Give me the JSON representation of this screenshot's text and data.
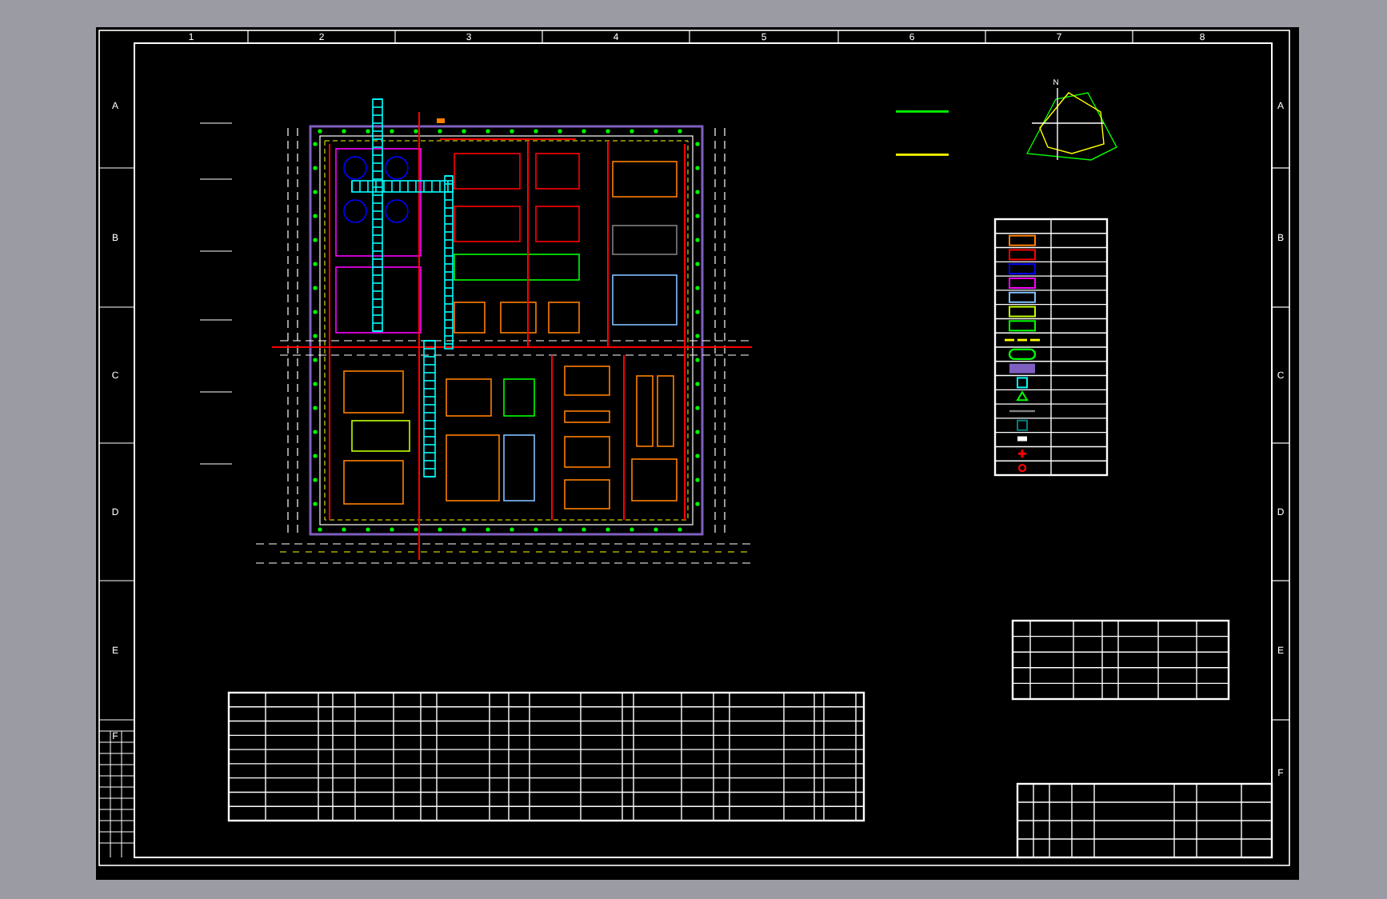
{
  "sheet": {
    "column_labels": [
      "1",
      "2",
      "3",
      "4",
      "5",
      "6",
      "7",
      "8"
    ],
    "row_labels_left": [
      "A",
      "B",
      "C",
      "D",
      "E",
      "F"
    ],
    "row_labels_right": [
      "A",
      "B",
      "C",
      "D",
      "E",
      "F"
    ],
    "compass": {
      "label": "N"
    },
    "wind_lines": [
      {
        "color": "#00ff00"
      },
      {
        "color": "#ffff00"
      }
    ],
    "legend": [
      {
        "kind": "rect",
        "color": "#ff8000"
      },
      {
        "kind": "rect",
        "color": "#ff0000"
      },
      {
        "kind": "rect",
        "color": "#0000ff"
      },
      {
        "kind": "rect",
        "color": "#ff00ff"
      },
      {
        "kind": "rect",
        "color": "#80c0ff"
      },
      {
        "kind": "rect",
        "color": "#c0ff00"
      },
      {
        "kind": "rect",
        "color": "#00ff00"
      },
      {
        "kind": "dashes",
        "color": "#ffff00"
      },
      {
        "kind": "hedge",
        "color": "#00ff00"
      },
      {
        "kind": "fill",
        "color": "#7f5fbf"
      },
      {
        "kind": "square",
        "color": "#00ffff"
      },
      {
        "kind": "tree",
        "color": "#00ff00"
      },
      {
        "kind": "line",
        "color": "#808080"
      },
      {
        "kind": "square",
        "color": "#008080"
      },
      {
        "kind": "lamp",
        "color": "#ffffff"
      },
      {
        "kind": "cross",
        "color": "#ff0000"
      },
      {
        "kind": "ring",
        "color": "#ff0000"
      }
    ]
  }
}
